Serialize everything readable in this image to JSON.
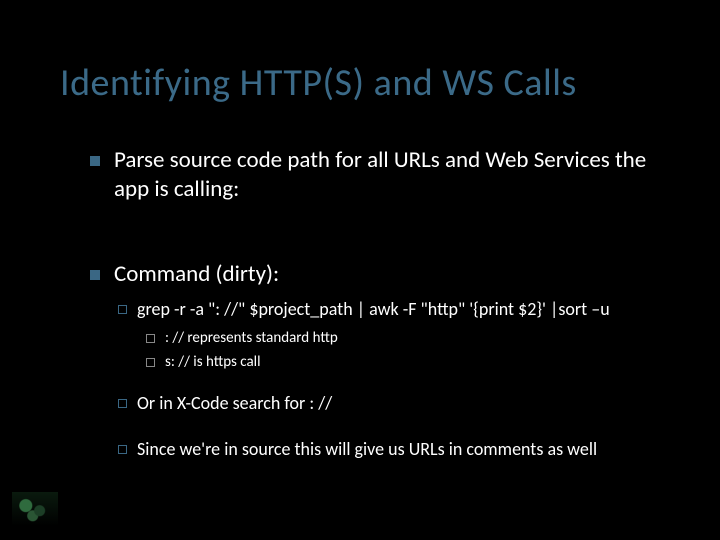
{
  "title": "Identifying HTTP(S) and WS Calls",
  "bullets": {
    "b1_1": "Parse source code path for all URLs and Web Services the app is calling:",
    "b1_2": "Command (dirty):",
    "b2_1": "grep -r -a \": //\" $project_path | awk -F \"http\" '{print $2}' |sort –u",
    "b3_1": " : // represents standard http",
    "b3_2": " s: // is https call",
    "b2_2": "Or in X-Code search for : //",
    "b2_3": "Since we're in source this will give us URLs in comments as well"
  }
}
